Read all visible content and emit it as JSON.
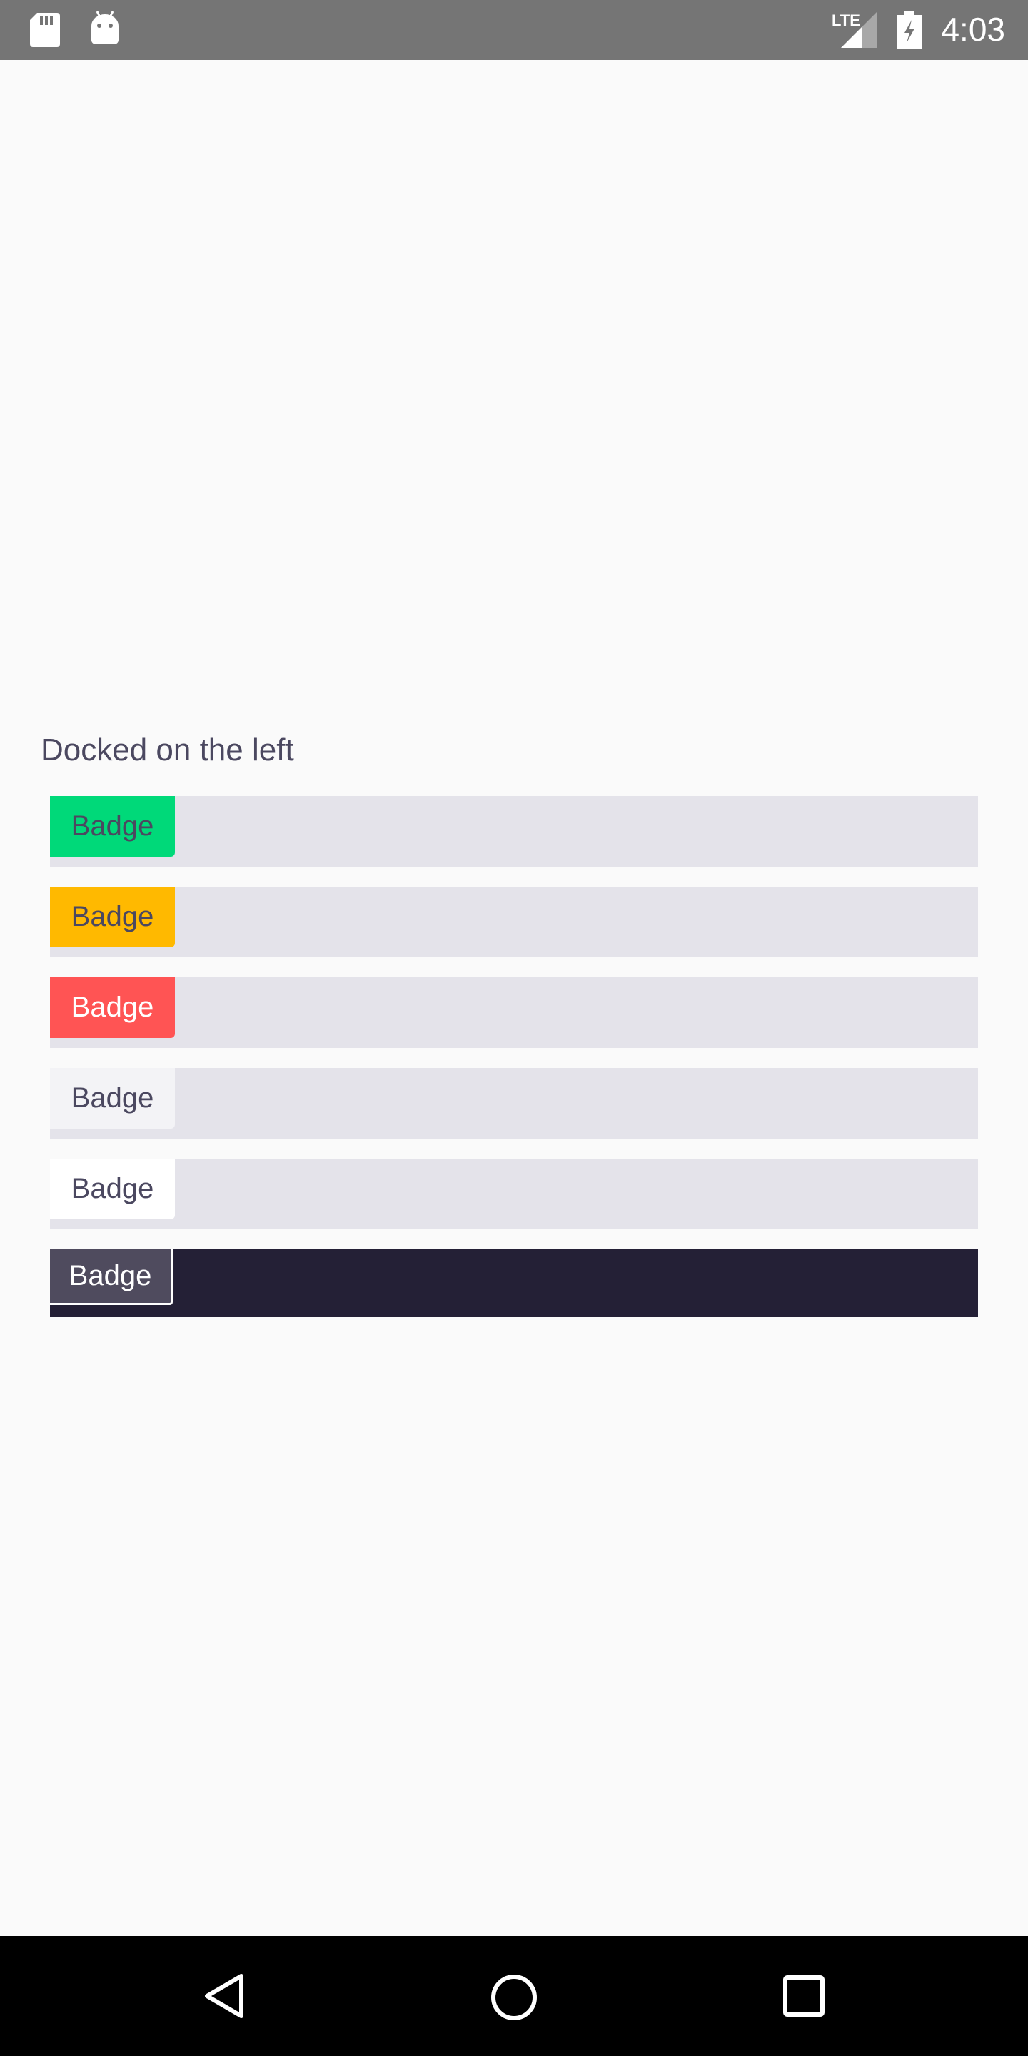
{
  "status_bar": {
    "time": "4:03",
    "network": "LTE"
  },
  "section_title": "Docked on the left",
  "badges": [
    {
      "label": "Badge",
      "variant": "success",
      "bg": "#00d979",
      "fg": "#4b4860"
    },
    {
      "label": "Badge",
      "variant": "warning",
      "bg": "#ffb900",
      "fg": "#4b4860"
    },
    {
      "label": "Badge",
      "variant": "danger",
      "bg": "#ff5454",
      "fg": "#ffffff"
    },
    {
      "label": "Badge",
      "variant": "light",
      "bg": "#f3f3f6",
      "fg": "#4b4860"
    },
    {
      "label": "Badge",
      "variant": "white",
      "bg": "#ffffff",
      "fg": "#4b4860"
    },
    {
      "label": "Badge",
      "variant": "dark",
      "bg": "#4f4b5e",
      "fg": "#ffffff"
    }
  ]
}
